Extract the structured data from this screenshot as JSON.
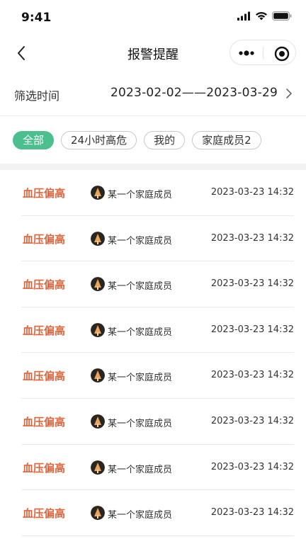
{
  "status_bar": {
    "time": "9:41"
  },
  "nav": {
    "title": "报警提醒"
  },
  "filter": {
    "label": "筛选时间",
    "range": "2023-02-02——2023-03-29"
  },
  "tags": [
    {
      "label": "全部",
      "active": true
    },
    {
      "label": "24小时高危",
      "active": false
    },
    {
      "label": "我的",
      "active": false
    },
    {
      "label": "家庭成员2",
      "active": false
    }
  ],
  "alerts": [
    {
      "type": "血压偏高",
      "member": "某一个家庭成员",
      "time": "2023-03-23 14:32"
    },
    {
      "type": "血压偏高",
      "member": "某一个家庭成员",
      "time": "2023-03-23 14:32"
    },
    {
      "type": "血压偏高",
      "member": "某一个家庭成员",
      "time": "2023-03-23 14:32"
    },
    {
      "type": "血压偏高",
      "member": "某一个家庭成员",
      "time": "2023-03-23 14:32"
    },
    {
      "type": "血压偏高",
      "member": "某一个家庭成员",
      "time": "2023-03-23 14:32"
    },
    {
      "type": "血压偏高",
      "member": "某一个家庭成员",
      "time": "2023-03-23 14:32"
    },
    {
      "type": "血压偏高",
      "member": "某一个家庭成员",
      "time": "2023-03-23 14:32"
    },
    {
      "type": "血压偏高",
      "member": "某一个家庭成员",
      "time": "2023-03-23 14:32"
    }
  ],
  "colors": {
    "accent": "#4cbf8f",
    "alert_text": "#e0643b"
  },
  "icons": {
    "back": "chevron-left-icon",
    "more": "more-dots-icon",
    "close": "target-close-icon",
    "filter_chevron": "chevron-right-icon"
  }
}
